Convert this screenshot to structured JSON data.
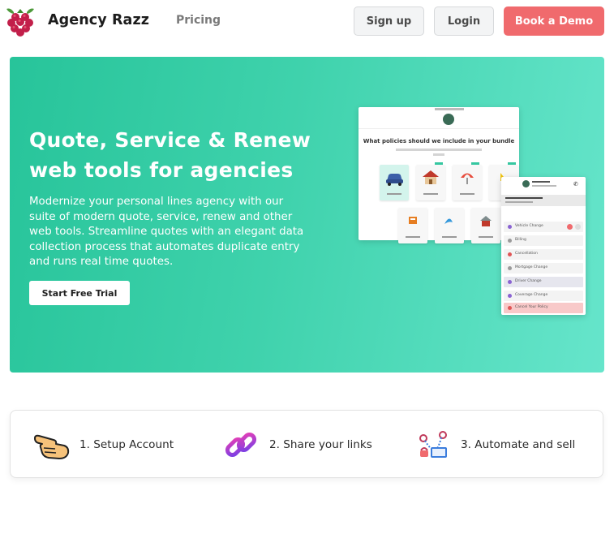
{
  "header": {
    "logo_icon": "raspberry-logo-icon",
    "brand": "Agency Razz",
    "nav": [
      {
        "label": "Pricing"
      }
    ],
    "buttons": {
      "signup": "Sign up",
      "login": "Login",
      "demo": "Book a Demo"
    }
  },
  "hero": {
    "title_line1": "Quote, Service & Renew",
    "title_line2": "web tools for agencies",
    "description": "Modernize your personal lines agency with our suite of modern quote, service, renew and other web tools. Streamline quotes with an elegant data collection process that automates duplicate entry and runs real time quotes.",
    "cta": "Start Free Trial",
    "mockup": {
      "bundle_question": "What policies should we include in your bundle",
      "options_icons": [
        "car-icon",
        "house-icon",
        "umbrella-icon",
        "boat-icon",
        "life-icon",
        "flood-icon",
        "condo-icon"
      ],
      "service_menu": [
        {
          "label": "Vehicle Change",
          "color": "#8a63d2"
        },
        {
          "label": "Billing",
          "color": "#9a9a9a"
        },
        {
          "label": "Cancellation",
          "color": "#e05555"
        },
        {
          "label": "Mortgage Change",
          "color": "#9a9a9a"
        },
        {
          "label": "Driver Change",
          "color": "#8a63d2"
        },
        {
          "label": "Coverage Change",
          "color": "#8a63d2"
        },
        {
          "label": "Cancel Your Policy",
          "color": "#e05555"
        }
      ]
    }
  },
  "steps": [
    {
      "label": "1. Setup Account",
      "icon": "pointing-hand-icon"
    },
    {
      "label": "2. Share your links",
      "icon": "chain-link-icon"
    },
    {
      "label": "3. Automate and sell",
      "icon": "automation-icon"
    }
  ],
  "colors": {
    "accent": "#f06a6d",
    "hero_start": "#27c49a",
    "hero_end": "#66e5cb"
  }
}
